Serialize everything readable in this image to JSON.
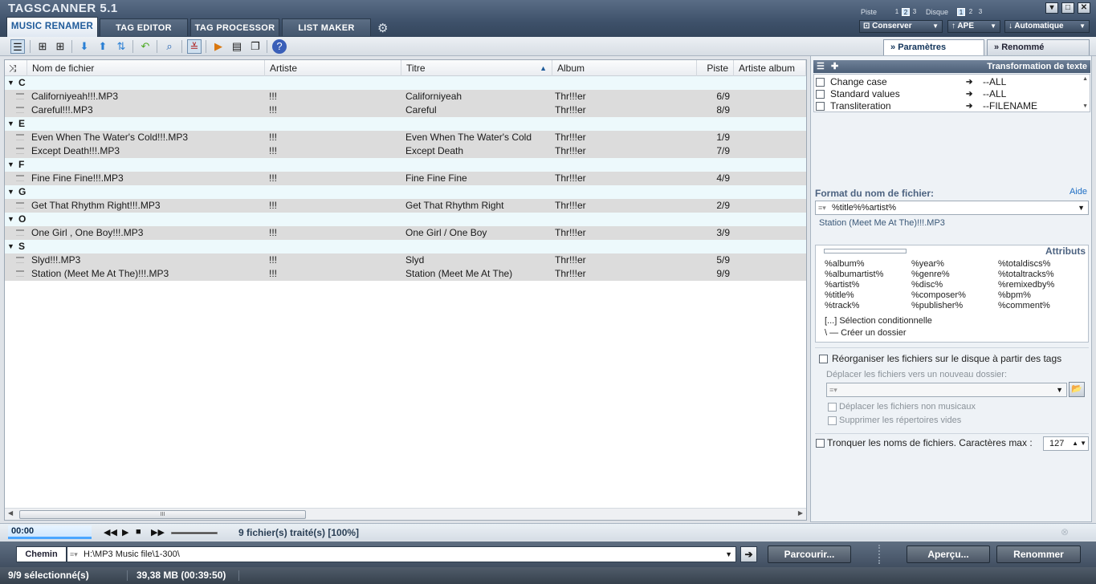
{
  "app_title": "TAGSCANNER 5.1",
  "title_controls": {
    "piste_label": "Piste",
    "piste_nums": [
      "1",
      "2",
      "3"
    ],
    "piste_active": "2",
    "disque_label": "Disque",
    "disque_nums": [
      "1",
      "2",
      "3"
    ],
    "disque_active": "1",
    "dropdowns": [
      "Conserver",
      "APE",
      "Automatique"
    ]
  },
  "main_tabs": [
    "Music renamer",
    "Tag editor",
    "Tag processor",
    "List maker"
  ],
  "right_tabs": [
    "Paramètres",
    "Renommé"
  ],
  "grid": {
    "columns": [
      "Nom de fichier",
      "Artiste",
      "Titre",
      "Album",
      "Piste",
      "Artiste album"
    ],
    "sorted_column": "Titre",
    "rows": [
      {
        "group": "C"
      },
      {
        "file": "Californiyeah!!!.MP3",
        "artist": "!!!",
        "title": "Californiyeah",
        "album": "Thr!!!er",
        "track": "6/9"
      },
      {
        "file": "Careful!!!.MP3",
        "artist": "!!!",
        "title": "Careful",
        "album": "Thr!!!er",
        "track": "8/9"
      },
      {
        "group": "E"
      },
      {
        "file": "Even When The Water's Cold!!!.MP3",
        "artist": "!!!",
        "title": "Even When The Water's Cold",
        "album": "Thr!!!er",
        "track": "1/9"
      },
      {
        "file": "Except Death!!!.MP3",
        "artist": "!!!",
        "title": "Except Death",
        "album": "Thr!!!er",
        "track": "7/9"
      },
      {
        "group": "F"
      },
      {
        "file": "Fine Fine Fine!!!.MP3",
        "artist": "!!!",
        "title": "Fine Fine Fine",
        "album": "Thr!!!er",
        "track": "4/9"
      },
      {
        "group": "G"
      },
      {
        "file": "Get That Rhythm Right!!!.MP3",
        "artist": "!!!",
        "title": "Get That Rhythm Right",
        "album": "Thr!!!er",
        "track": "2/9"
      },
      {
        "group": "O"
      },
      {
        "file": "One Girl , One Boy!!!.MP3",
        "artist": "!!!",
        "title": "One Girl / One Boy",
        "album": "Thr!!!er",
        "track": "3/9"
      },
      {
        "group": "S"
      },
      {
        "file": "Slyd!!!.MP3",
        "artist": "!!!",
        "title": "Slyd",
        "album": "Thr!!!er",
        "track": "5/9"
      },
      {
        "file": "Station (Meet Me At The)!!!.MP3",
        "artist": "!!!",
        "title": "Station (Meet Me At The)",
        "album": "Thr!!!er",
        "track": "9/9"
      }
    ],
    "scroll_thumb": "III"
  },
  "panel": {
    "transform_title": "Transformation de texte",
    "transforms": [
      {
        "label": "Change case",
        "value": "--ALL"
      },
      {
        "label": "Standard values",
        "value": "--ALL"
      },
      {
        "label": "Transliteration",
        "value": "--FILENAME"
      }
    ],
    "format_label": "Format du nom de fichier:",
    "help_link": "Aide",
    "format_value": "%title%%artist%",
    "preview": "Station (Meet Me At The)!!!.MP3",
    "attributes_title": "Attributs",
    "attributes": [
      "%album%",
      "%year%",
      "%totaldiscs%",
      "%albumartist%",
      "%genre%",
      "%totaltracks%",
      "%artist%",
      "%disc%",
      "%remixedby%",
      "%title%",
      "%composer%",
      "%bpm%",
      "%track%",
      "%publisher%",
      "%comment%"
    ],
    "conditional": "[...] Sélection conditionnelle",
    "folder": "\\ — Créer un dossier",
    "reorganize": "Réorganiser les fichiers sur le disque à partir des tags",
    "move_to_label": "Déplacer les fichiers vers un nouveau dossier:",
    "move_nonmusic": "Déplacer les fichiers non musicaux",
    "delete_empty": "Supprimer les répertoires vides",
    "truncate": "Tronquer les noms de fichiers. Caractères max :",
    "max_chars": "127"
  },
  "player": {
    "time": "00:00",
    "status": "9 fichier(s) traité(s) [100%]",
    "volume": 1.0
  },
  "path": {
    "label": "Chemin",
    "value": "H:\\MP3 Music file\\1-300\\",
    "browse": "Parcourir...",
    "preview": "Aperçu...",
    "rename": "Renommer"
  },
  "statusbar": {
    "selected": "9/9 sélectionné(s)",
    "size": "39,38 MB (00:39:50)"
  },
  "colors": {
    "accent": "#1f5b9a",
    "group_row": "#edf9fc",
    "item_row": "#dcdcdc"
  }
}
